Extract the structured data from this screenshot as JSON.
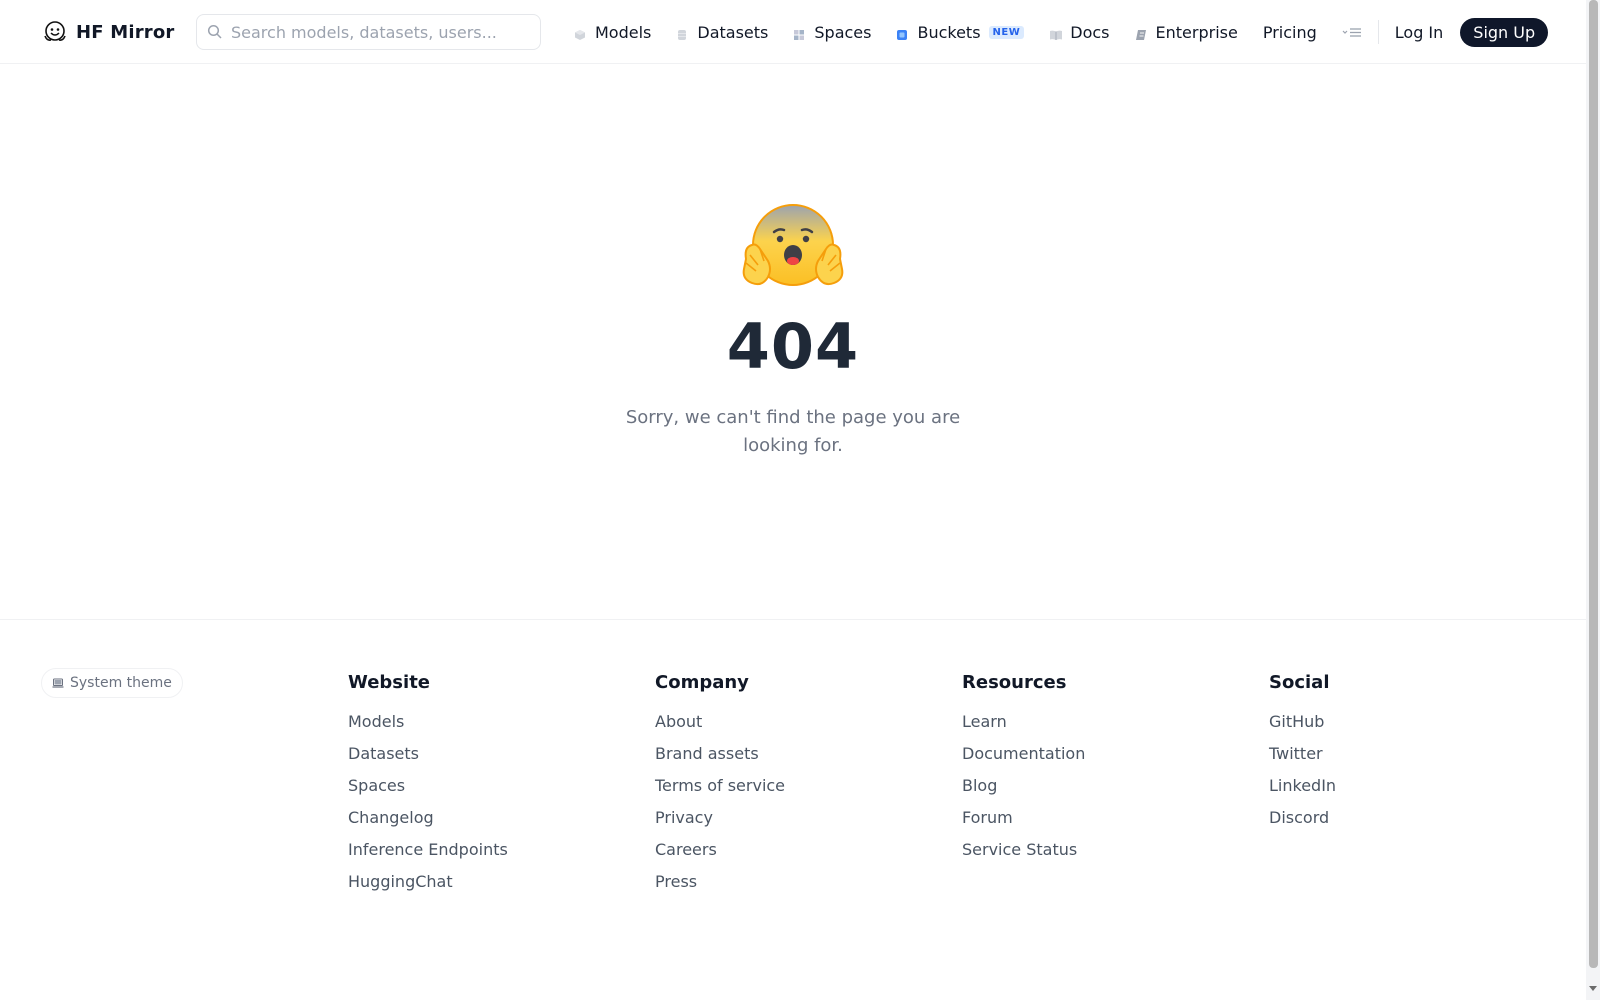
{
  "brand": {
    "name": "HF Mirror",
    "logo_icon": "hugging-face-logo"
  },
  "search": {
    "placeholder": "Search models, datasets, users..."
  },
  "nav": {
    "items": [
      {
        "label": "Models",
        "icon": "models-icon"
      },
      {
        "label": "Datasets",
        "icon": "datasets-icon"
      },
      {
        "label": "Spaces",
        "icon": "spaces-icon"
      },
      {
        "label": "Buckets",
        "icon": "buckets-icon",
        "badge": "NEW"
      },
      {
        "label": "Docs",
        "icon": "docs-icon"
      },
      {
        "label": "Enterprise",
        "icon": "enterprise-icon"
      },
      {
        "label": "Pricing"
      }
    ],
    "login": "Log In",
    "signup": "Sign Up"
  },
  "error": {
    "code": "404",
    "message": "Sorry, we can't find the page you are looking for.",
    "emoji_icon": "scared-hugging-face-icon"
  },
  "footer": {
    "theme_button": "System theme",
    "columns": [
      {
        "title": "Website",
        "links": [
          "Models",
          "Datasets",
          "Spaces",
          "Changelog",
          "Inference Endpoints",
          "HuggingChat"
        ]
      },
      {
        "title": "Company",
        "links": [
          "About",
          "Brand assets",
          "Terms of service",
          "Privacy",
          "Careers",
          "Press"
        ]
      },
      {
        "title": "Resources",
        "links": [
          "Learn",
          "Documentation",
          "Blog",
          "Forum",
          "Service Status"
        ]
      },
      {
        "title": "Social",
        "links": [
          "GitHub",
          "Twitter",
          "LinkedIn",
          "Discord"
        ]
      }
    ]
  },
  "colors": {
    "accent_badge": "#2563eb",
    "signup_bg": "#0f172a",
    "heading": "#1f2937",
    "muted": "#6b7280"
  }
}
